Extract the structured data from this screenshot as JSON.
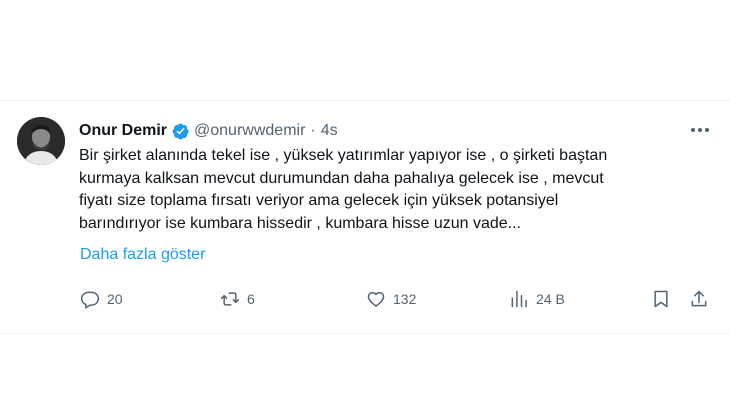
{
  "tweet": {
    "author_name": "Onur Demir",
    "handle": "@onurwwdemir",
    "separator": "·",
    "time": "4s",
    "text_lines": [
      "Bir şirket alanında tekel ise , yüksek yatırımlar yapıyor ise , o şirketi baştan",
      "kurmaya kalksan mevcut durumundan daha pahalıya gelecek ise , mevcut",
      "fiyatı size toplama fırsatı veriyor ama gelecek için yüksek potansiyel",
      "barındırıyor ise kumbara hissedir , kumbara hisse uzun vade..."
    ],
    "show_more": "Daha fazla göster",
    "verified_color": "#1d9bf0"
  },
  "actions": {
    "reply_count": "20",
    "retweet_count": "6",
    "like_count": "132",
    "views_count": "24 B"
  },
  "icons": {
    "verified": "verified-badge-icon",
    "more": "more-options-icon",
    "reply": "reply-icon",
    "retweet": "retweet-icon",
    "like": "heart-icon",
    "views": "views-icon",
    "bookmark": "bookmark-icon",
    "share": "share-icon"
  },
  "colors": {
    "text": "#0f1419",
    "secondary": "#536471",
    "link": "#1d9bf0"
  }
}
